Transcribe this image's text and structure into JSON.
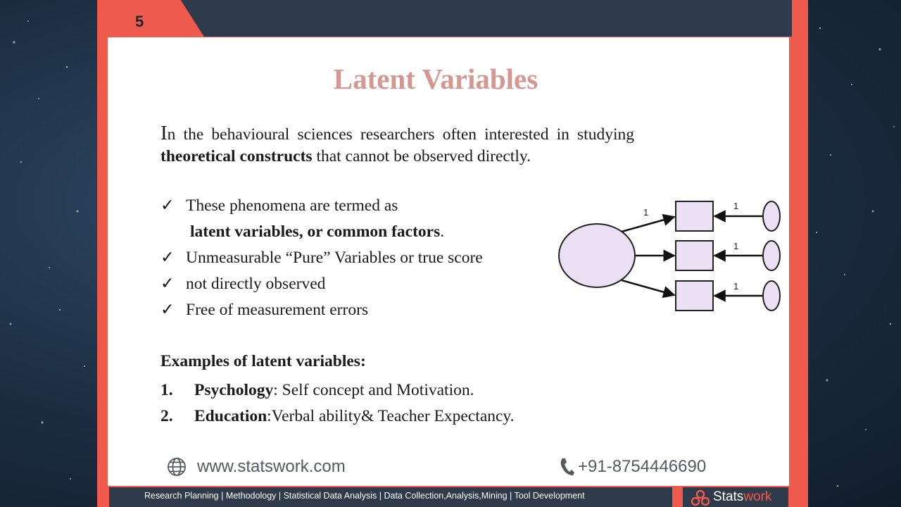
{
  "page_number": "5",
  "title": "Latent Variables",
  "intro": {
    "first_letter": "I",
    "text_before_bold": "n the behavioural sciences researchers often interested in studying ",
    "bold": "theoretical constructs",
    "text_after_bold": " that cannot be observed directly."
  },
  "bullets": {
    "check_glyph": "✓",
    "b1_text": "These phenomena are termed as",
    "b1_cont_bold": "latent variables, or common factors",
    "b1_cont_end": ".",
    "b2_text": "Unmeasurable “Pure” Variables or true score",
    "b3_text": "not directly observed",
    "b4_text": "Free of measurement errors"
  },
  "examples": {
    "heading": "Examples of latent variables:",
    "item1_num": "1.",
    "item1_bold": "Psychology",
    "item1_rest": ": Self concept and Motivation.",
    "item2_num": "2.",
    "item2_bold": "Education",
    "item2_rest": ":Verbal ability& Teacher Expectancy."
  },
  "diagram": {
    "labels": [
      "1",
      "1",
      "1",
      "1"
    ],
    "shape_fill": "#ebe0f4"
  },
  "footer": {
    "website": "www.statswork.com",
    "website_icon": "globe-icon",
    "phone": "+91-8754446690",
    "phone_icon": "phone-icon",
    "services": "Research Planning | Methodology | Statistical Data Analysis | Data Collection,Analysis,Mining | Tool Development",
    "logo_part1": "Stats",
    "logo_part2": "work",
    "logo_icon": "statswork-logo-icon"
  },
  "colors": {
    "accent": "#ee5a4c",
    "dark_bar": "#2f3a4a",
    "title": "#d49791"
  }
}
